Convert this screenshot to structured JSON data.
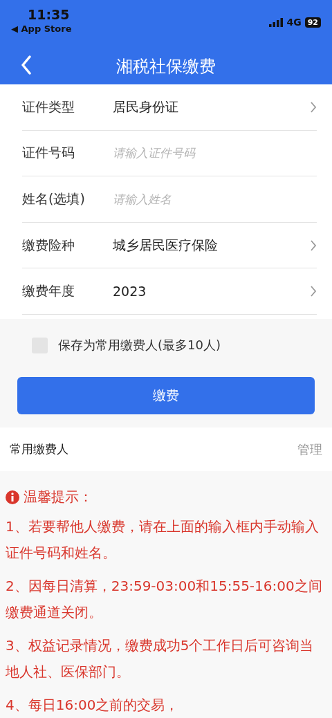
{
  "status_bar": {
    "time": "11:35",
    "back_app": "◀ App Store",
    "network": "4G",
    "battery": "92"
  },
  "header": {
    "title": "湘税社保缴费"
  },
  "form": [
    {
      "kind": "select",
      "label": "证件类型",
      "value": "居民身份证"
    },
    {
      "kind": "input",
      "label": "证件号码",
      "placeholder": "请输入证件号码"
    },
    {
      "kind": "input",
      "label": "姓名(选填)",
      "placeholder": "请输入姓名"
    },
    {
      "kind": "select",
      "label": "缴费险种",
      "value": "城乡居民医疗保险"
    },
    {
      "kind": "select",
      "label": "缴费年度",
      "value": "2023"
    }
  ],
  "save_payer": {
    "label": "保存为常用缴费人(最多10人)",
    "checked": false
  },
  "pay_button": "缴费",
  "frequent_payers": {
    "title": "常用缴费人",
    "manage": "管理"
  },
  "tips": {
    "title": "温馨提示：",
    "items": [
      "1、若要帮他人缴费，请在上面的输入框内手动输入证件号码和姓名。",
      "2、因每日清算，23:59-03:00和15:55-16:00之间缴费通道关闭。",
      "3、权益记录情况，缴费成功5个工作日后可咨询当地人社、医保部门。",
      "4、每日16:00之前的交易，"
    ]
  }
}
